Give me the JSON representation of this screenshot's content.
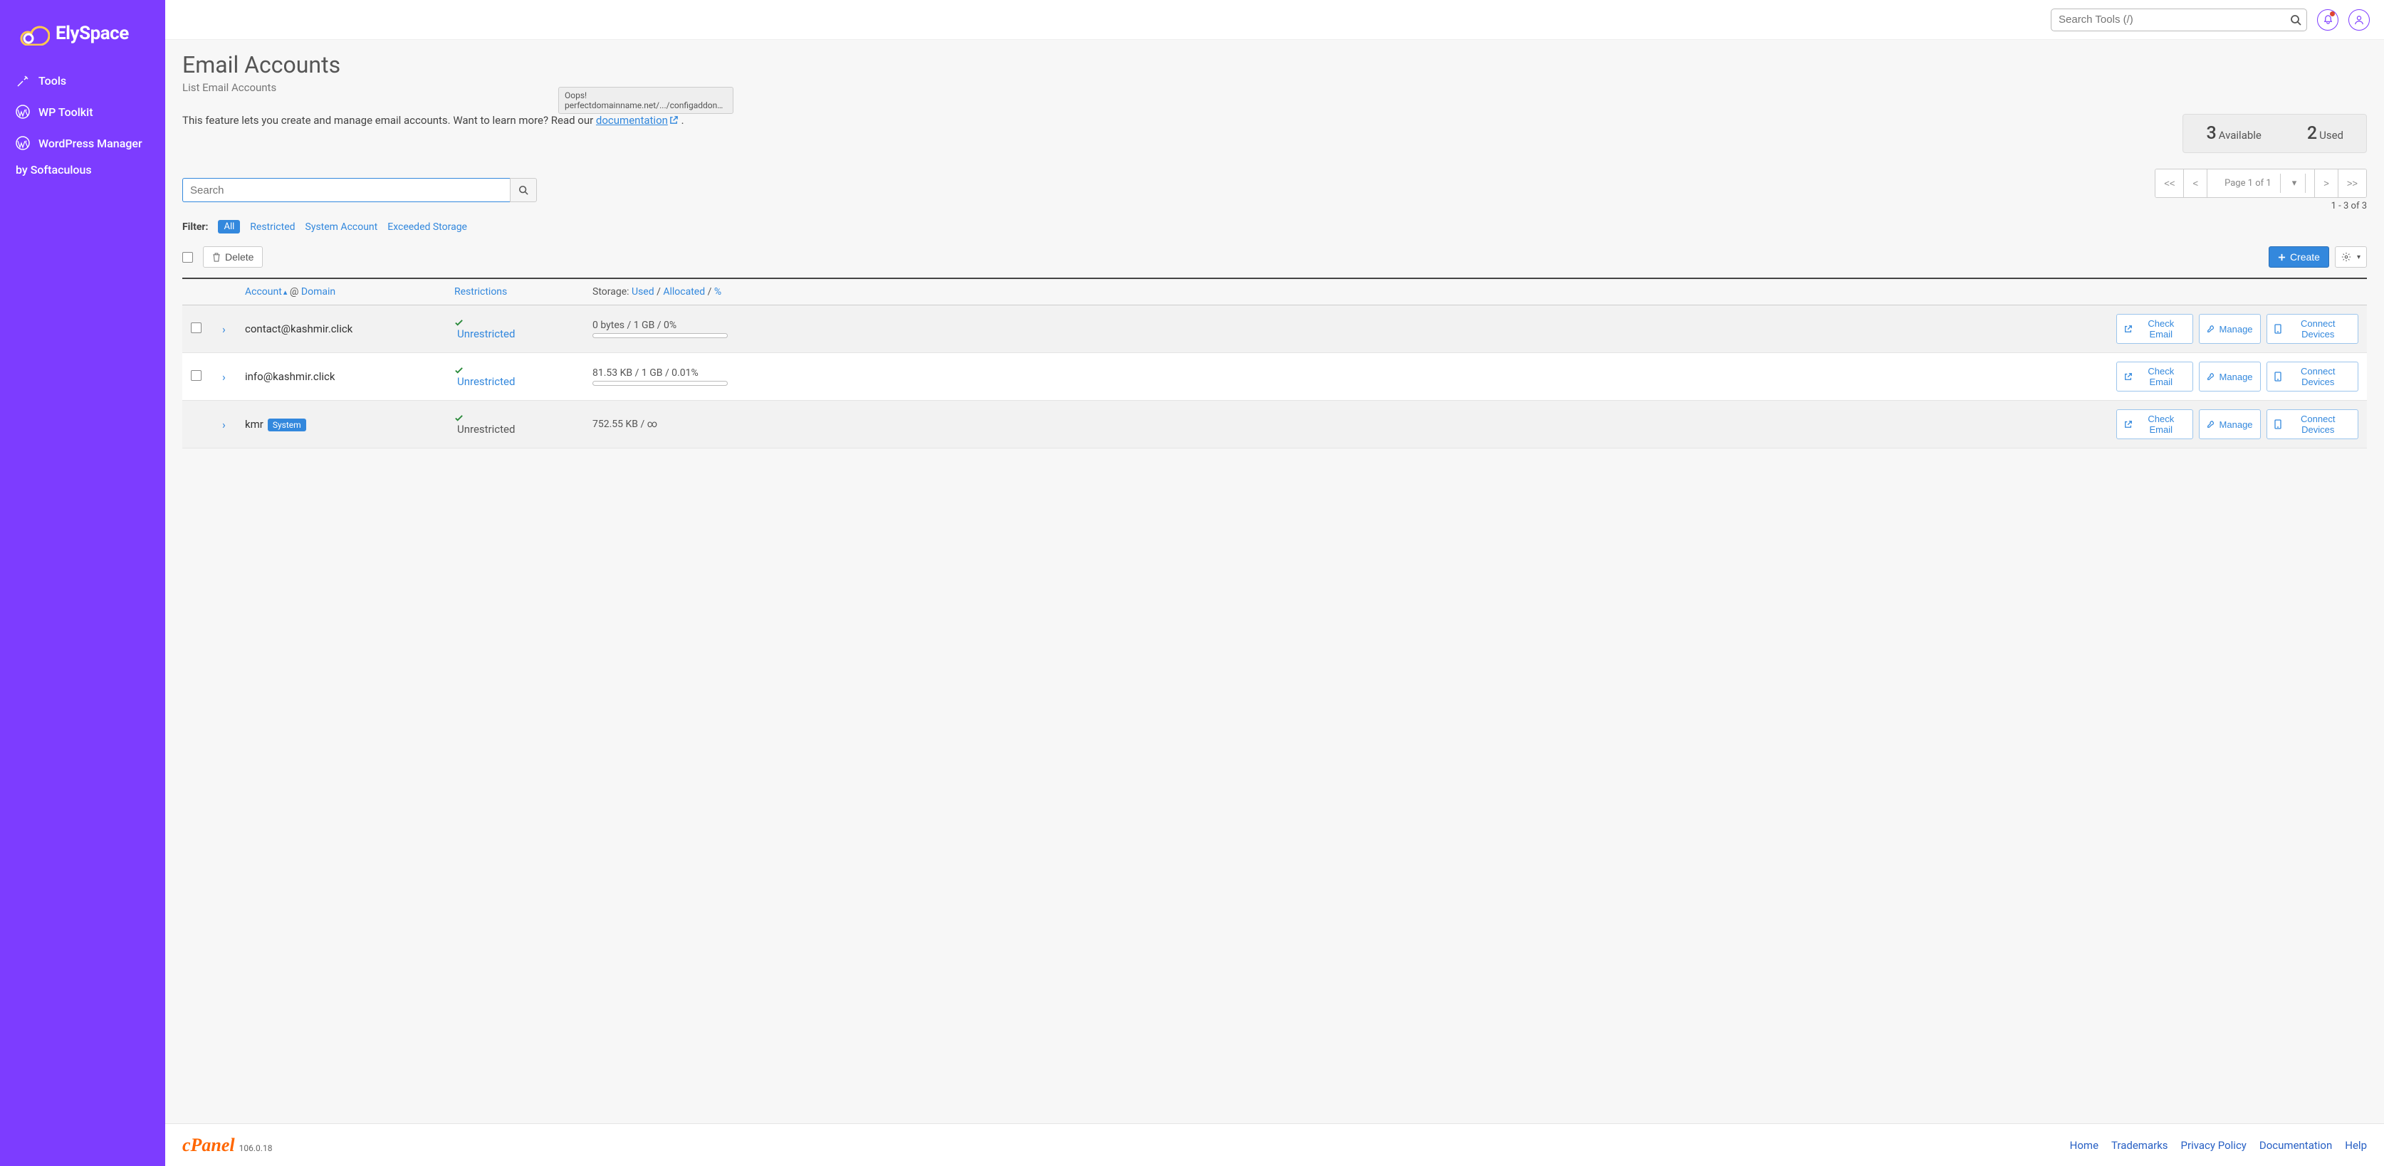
{
  "brand": {
    "name": "ElySpace"
  },
  "sidebar": {
    "items": [
      {
        "label": "Tools"
      },
      {
        "label": "WP Toolkit"
      },
      {
        "label": "WordPress Manager"
      }
    ],
    "subline": "by Softaculous"
  },
  "topbar": {
    "search_placeholder": "Search Tools (/)"
  },
  "page": {
    "title": "Email Accounts",
    "subtitle": "List Email Accounts",
    "intro_prefix": "This feature lets you create and manage email accounts. Want to learn more? Read our ",
    "intro_link": "documentation",
    "intro_suffix": " ."
  },
  "tooltip": {
    "line1": "Oops!",
    "line2": "perfectdomainname.net/.../configaddonmods...."
  },
  "stats": {
    "available_num": "3",
    "available_lbl": "Available",
    "used_num": "2",
    "used_lbl": "Used"
  },
  "search": {
    "placeholder": "Search"
  },
  "pagination": {
    "first": "<<",
    "prev": "<",
    "label": "Page 1 of 1",
    "next": ">",
    "last": ">>",
    "range": "1 - 3 of 3"
  },
  "filter": {
    "label": "Filter:",
    "all": "All",
    "links": [
      "Restricted",
      "System Account",
      "Exceeded Storage"
    ]
  },
  "actions": {
    "delete": "Delete",
    "create": "Create"
  },
  "columns": {
    "account": "Account",
    "at": "@",
    "domain": "Domain",
    "restrictions": "Restrictions",
    "storage_prefix": "Storage: ",
    "used": "Used",
    "allocated": "Allocated",
    "percent": "%"
  },
  "row_labels": {
    "check_email": "Check Email",
    "manage": "Manage",
    "connect": "Connect Devices",
    "unrestricted": "Unrestricted",
    "system_badge": "System"
  },
  "rows": [
    {
      "email": "contact@kashmir.click",
      "storage": "0 bytes / 1 GB / 0%",
      "progress": 0,
      "system": false,
      "restr_link": true,
      "checkbox": true
    },
    {
      "email": "info@kashmir.click",
      "storage": "81.53 KB / 1 GB / 0.01%",
      "progress": 0.01,
      "system": false,
      "restr_link": true,
      "checkbox": true
    },
    {
      "email": "kmr",
      "storage": "752.55 KB / ∞",
      "progress": null,
      "system": true,
      "restr_link": false,
      "checkbox": false
    }
  ],
  "footer": {
    "logo": "cPanel",
    "version": "106.0.18",
    "links": [
      "Home",
      "Trademarks",
      "Privacy Policy",
      "Documentation",
      "Help"
    ]
  }
}
